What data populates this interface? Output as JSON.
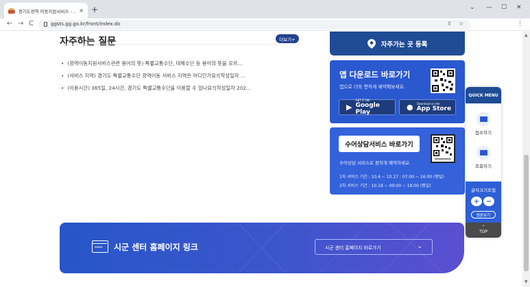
{
  "browser": {
    "tab_title": "경기도광역 이동지원서비스 - ...",
    "tab_close": "×",
    "new_tab": "+",
    "url": "ggsts.gg.go.kr/front/index.do",
    "window_controls": [
      "⌄",
      "—",
      "☐",
      "✕"
    ],
    "nav": {
      "back": "←",
      "forward": "→",
      "reload": "C"
    },
    "menu": "⋮"
  },
  "faq": {
    "title": "자주하는 질문",
    "more": "더보기+",
    "items": [
      "(광역이동지원서비스관련 용어의 뜻) 특별교통수단, 대체수단 등 용어의 뜻을 모르...",
      "(서비스 지역) 경기도 특별교통수단 광역이동 서비스 지역은 어디인가요?[작성일자 ...",
      "(이용시간) 365일, 24시간, 경기도 특별교통수단을 이용할 수 있나요?[작성일자 202..."
    ]
  },
  "register": {
    "label": "자주가는 곳 등록"
  },
  "app_download": {
    "title": "앱 다운로드 바로가기",
    "subtitle": "앱으로 더욱 편하게 예약해보세요.",
    "google": {
      "small": "GET IT ON",
      "big": "Google Play"
    },
    "apple": {
      "small": "Download on the",
      "big": "App Store"
    }
  },
  "sign_language": {
    "button": "수어상담서비스 바로가기",
    "subtitle": "수어상담 서비스로 편하게 예약하세요.",
    "lines": [
      "1차 서비스 기간 : 10.4 ~ 10.17 : 07:00 ~ 16:00 (평일)",
      "2차 서비스 기간 : 10.18 ~ 09:00 ~ 18:00 (평일)"
    ]
  },
  "banner": {
    "icon_text": "www.",
    "title": "시군 센터 홈페이지 링크",
    "select": "시군 센터 홈페이지 바로가기",
    "chevron": "⌄"
  },
  "quick_menu": {
    "title": "QUICK MENU",
    "items": [
      "접수하기",
      "조회하기"
    ],
    "font_label": "글자크기조절",
    "plus": "+",
    "minus": "−",
    "reset": "원본보기",
    "top": "TOP"
  },
  "colors": {
    "navy": "#1f4c95",
    "app_blue": "#2a58cf",
    "sign_blue": "#3462db"
  }
}
